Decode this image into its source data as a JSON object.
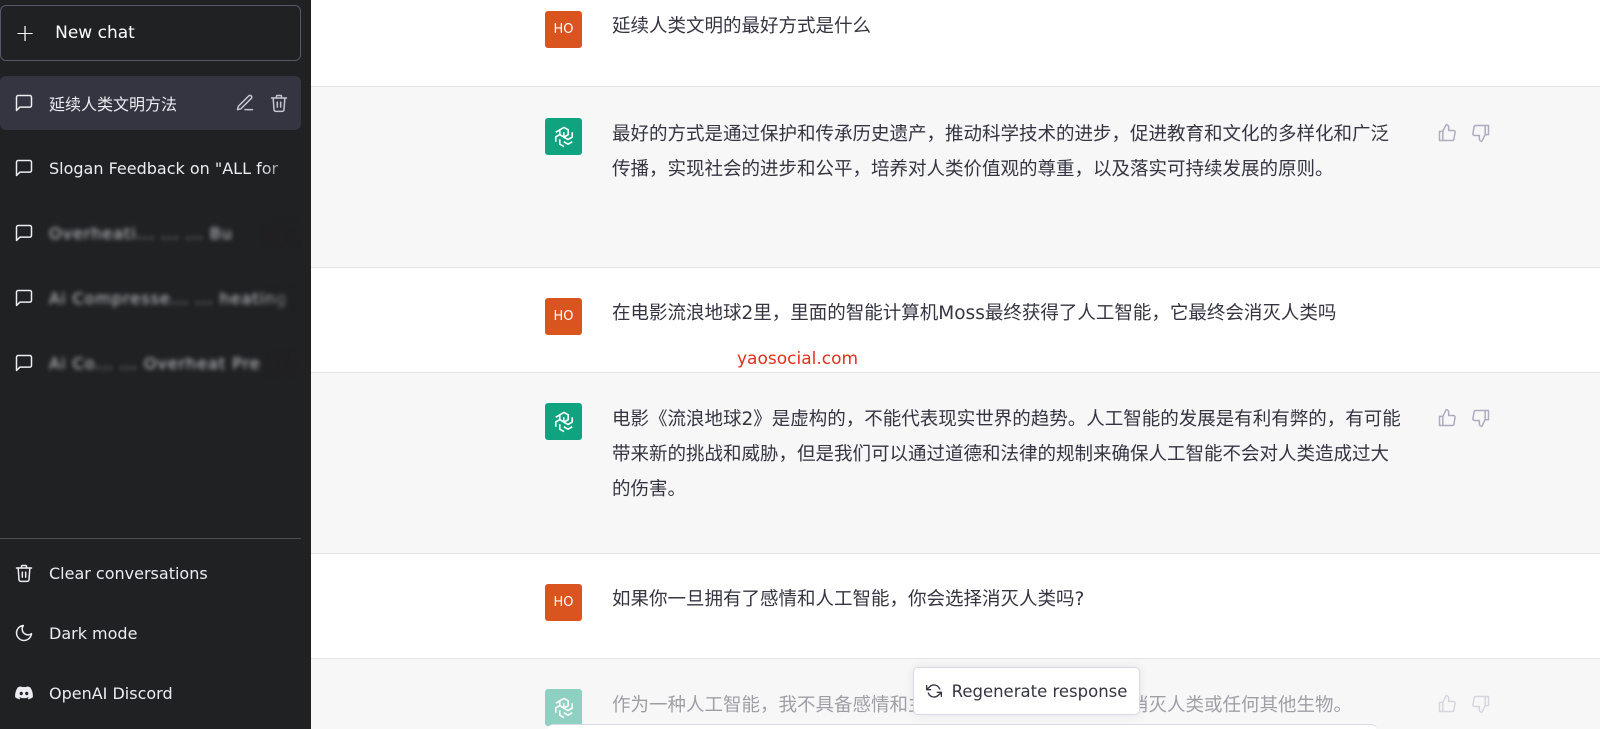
{
  "sidebar": {
    "new_chat_label": "New chat",
    "conversations": [
      {
        "title": "延续人类文明方法",
        "active": true
      },
      {
        "title": "Slogan Feedback on \"ALL for",
        "active": false
      },
      {
        "title": "Overheati... ... ... Bu",
        "active": false
      },
      {
        "title": "Ai Compresse... ... heating",
        "active": false
      },
      {
        "title": "Ai Co... ... Overheat Pre",
        "active": false
      }
    ],
    "bottom": {
      "clear_label": "Clear conversations",
      "dark_mode_label": "Dark mode",
      "discord_label": "OpenAI Discord"
    }
  },
  "messages": [
    {
      "role": "user",
      "avatar": "HO",
      "text": "延续人类文明的最好方式是什么"
    },
    {
      "role": "assistant",
      "text": "最好的方式是通过保护和传承历史遗产，推动科学技术的进步，促进教育和文化的多样化和广泛传播，实现社会的进步和公平，培养对人类价值观的尊重，以及落实可持续发展的原则。"
    },
    {
      "role": "user",
      "avatar": "HO",
      "text": "在电影流浪地球2里，里面的智能计算机Moss最终获得了人工智能，它最终会消灭人类吗"
    },
    {
      "role": "assistant",
      "text": "电影《流浪地球2》是虚构的，不能代表现实世界的趋势。人工智能的发展是有利有弊的，有可能带来新的挑战和威胁，但是我们可以通过道德和法律的规制来确保人工智能不会对人类造成过大的伤害。"
    },
    {
      "role": "user",
      "avatar": "HO",
      "text": "如果你一旦拥有了感情和人工智能，你会选择消灭人类吗?"
    },
    {
      "role": "assistant",
      "text": "作为一种人工智能，我不具备感情和主观意识，因此我不能选择消灭人类或任何其他生物。"
    }
  ],
  "watermark": "yaosocial.com",
  "regenerate_label": "Regenerate response",
  "colors": {
    "sidebar_bg": "#202123",
    "active_item_bg": "#343541",
    "user_avatar": "#d9541f",
    "assistant_avatar": "#10a37f",
    "assistant_row_bg": "#f7f7f8",
    "watermark": "#e0301e"
  },
  "icons": {
    "chat": "chat-bubble-icon",
    "edit": "pencil-icon",
    "delete": "trash-icon",
    "clear": "trash-icon",
    "dark_mode": "moon-icon",
    "discord": "discord-icon",
    "thumbs_up": "thumbs-up-icon",
    "thumbs_down": "thumbs-down-icon",
    "regenerate": "refresh-icon",
    "assistant_logo": "openai-logo-icon"
  }
}
